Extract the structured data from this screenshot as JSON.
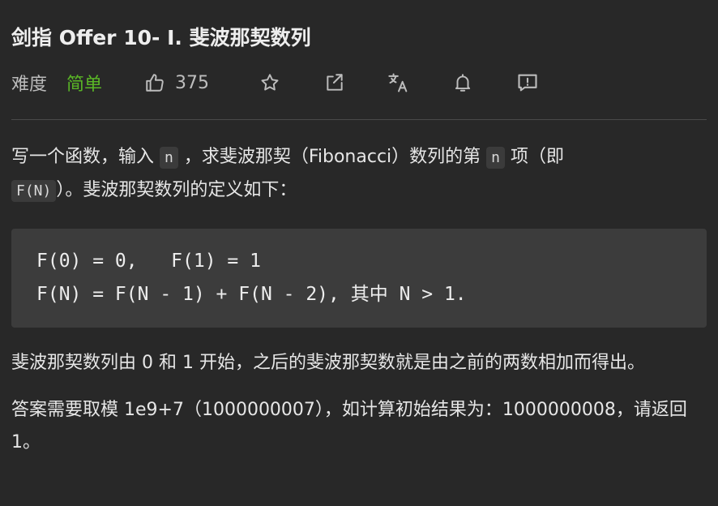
{
  "problem": {
    "title": "剑指 Offer 10- I. 斐波那契数列"
  },
  "meta": {
    "difficulty_label": "难度",
    "difficulty_value": "简单",
    "likes": "375",
    "icons": [
      "thumbs-up-icon",
      "star-icon",
      "share-icon",
      "translate-icon",
      "bell-icon",
      "feedback-icon"
    ],
    "colors": {
      "easy": "#5ab726",
      "background": "#282828",
      "code_bg": "#3c3c3c"
    }
  },
  "description": {
    "p1_part1": "写一个函数，输入 ",
    "p1_code1": "n",
    "p1_part2": " ，求斐波那契（Fibonacci）数列的第 ",
    "p1_code2": "n",
    "p1_part3": " 项（即 ",
    "p1_code3": "F(N)",
    "p1_part4": "）。斐波那契数列的定义如下：",
    "formula_line1": "F(0) = 0,   F(1) = 1",
    "formula_line2": "F(N) = F(N - 1) + F(N - 2), 其中 N > 1.",
    "p2": "斐波那契数列由 0 和 1 开始，之后的斐波那契数就是由之前的两数相加而得出。",
    "p3": "答案需要取模 1e9+7（1000000007），如计算初始结果为：1000000008，请返回 1。"
  }
}
